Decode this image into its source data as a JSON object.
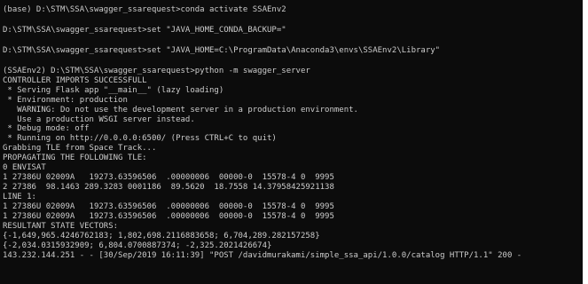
{
  "terminal": {
    "lines": [
      "(base) D:\\STM\\SSA\\swagger_ssarequest>conda activate SSAEnv2",
      "",
      "D:\\STM\\SSA\\swagger_ssarequest>set \"JAVA_HOME_CONDA_BACKUP=\"",
      "",
      "D:\\STM\\SSA\\swagger_ssarequest>set \"JAVA_HOME=C:\\ProgramData\\Anaconda3\\envs\\SSAEnv2\\Library\"",
      "",
      "(SSAEnv2) D:\\STM\\SSA\\swagger_ssarequest>python -m swagger_server",
      "CONTROLLER IMPORTS SUCCESSFULL",
      " * Serving Flask app \"__main__\" (lazy loading)",
      " * Environment: production",
      "   WARNING: Do not use the development server in a production environment.",
      "   Use a production WSGI server instead.",
      " * Debug mode: off",
      " * Running on http://0.0.0.0:6500/ (Press CTRL+C to quit)",
      "Grabbing TLE from Space Track...",
      "PROPAGATING THE FOLLOWING TLE:",
      "0 ENVISAT",
      "1 27386U 02009A   19273.63596506  .00000006  00000-0  15578-4 0  9995",
      "2 27386  98.1463 289.3283 0001186  89.5620  18.7558 14.37958425921138",
      "LINE 1:",
      "1 27386U 02009A   19273.63596506  .00000006  00000-0  15578-4 0  9995",
      "1 27386U 02009A   19273.63596506  .00000006  00000-0  15578-4 0  9995",
      "RESULTANT STATE VECTORS:",
      "{-1,649,965.4246762183; 1,802,698.2116883658; 6,704,289.282157258}",
      "{-2,034.0315932909; 6,804.0700887374; -2,325.2021426674}",
      "143.232.144.251 - - [30/Sep/2019 16:11:39] \"POST /davidmurakami/simple_ssa_api/1.0.0/catalog HTTP/1.1\" 200 -"
    ]
  }
}
